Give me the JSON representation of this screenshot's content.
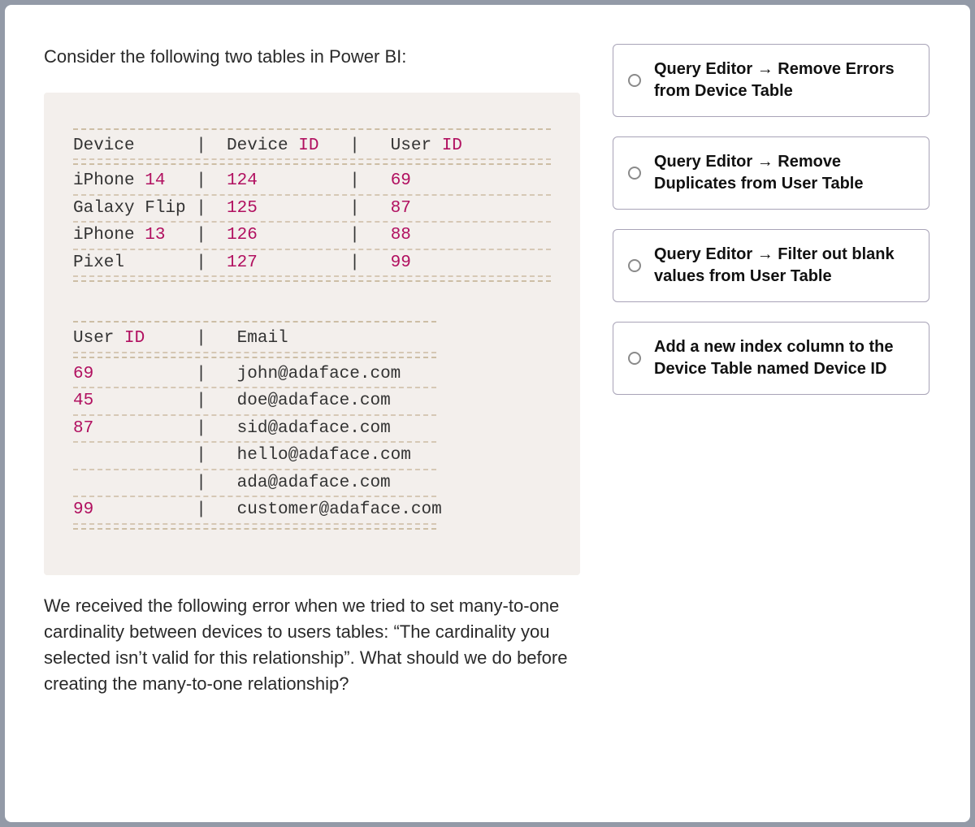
{
  "intro": "Consider the following two tables in Power BI:",
  "followup": "We received the following error when we tried to set many-to-one cardinality between devices to users tables: “The cardinality you selected isn’t valid for this relationship”. What should we do before creating the many-to-one relationship?",
  "tables": {
    "device": {
      "headers": [
        "Device",
        "Device ID",
        "User ID"
      ],
      "rows": [
        {
          "device": "iPhone 14",
          "device_id": "124",
          "user_id": "69"
        },
        {
          "device": "Galaxy Flip",
          "device_id": "125",
          "user_id": "87"
        },
        {
          "device": "iPhone 13",
          "device_id": "126",
          "user_id": "88"
        },
        {
          "device": "Pixel",
          "device_id": "127",
          "user_id": "99"
        }
      ]
    },
    "user": {
      "headers": [
        "User ID",
        "Email"
      ],
      "rows": [
        {
          "user_id": "69",
          "email": "john@adaface.com"
        },
        {
          "user_id": "45",
          "email": "doe@adaface.com"
        },
        {
          "user_id": "87",
          "email": "sid@adaface.com"
        },
        {
          "user_id": "",
          "email": "hello@adaface.com"
        },
        {
          "user_id": "",
          "email": "ada@adaface.com"
        },
        {
          "user_id": "99",
          "email": "customer@adaface.com"
        }
      ]
    }
  },
  "code_lines": {
    "device_header": "Device      |  Device <ID>   |   User <ID>",
    "device_row_0": "iPhone <14>   |  <124>         |   <69>",
    "device_row_1": "Galaxy Flip |  <125>         |   <87>",
    "device_row_2": "iPhone <13>   |  <126>         |   <88>",
    "device_row_3": "Pixel       |  <127>         |   <99>",
    "user_header": "User <ID>     |   Email",
    "user_row_0": "<69>          |   john@adaface.com",
    "user_row_1": "<45>          |   doe@adaface.com",
    "user_row_2": "<87>          |   sid@adaface.com",
    "user_row_3": "            |   hello@adaface.com",
    "user_row_4": "            |   ada@adaface.com",
    "user_row_5": "<99>          |   customer@adaface.com"
  },
  "options": [
    "Query Editor → Remove Errors from Device Table",
    "Query Editor → Remove Duplicates from User Table",
    "Query Editor → Filter out blank values from User Table",
    "Add a new index column to the Device Table named Device ID"
  ]
}
